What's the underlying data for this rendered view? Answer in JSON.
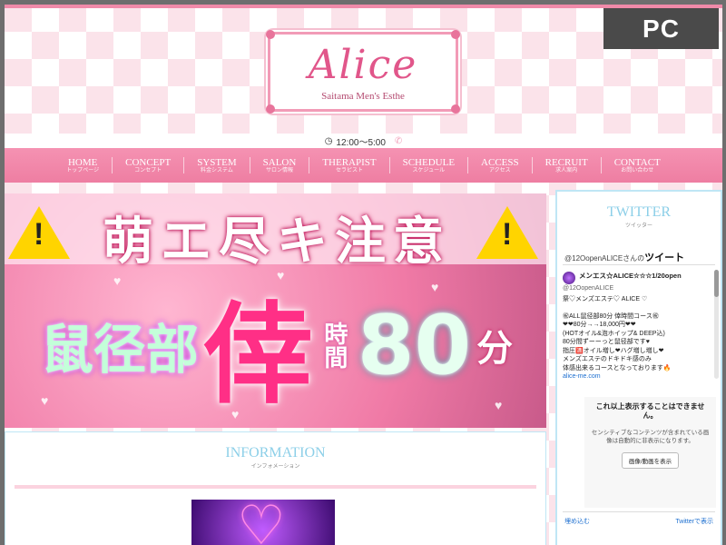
{
  "badge": "PC",
  "brand": {
    "logo": "Alice",
    "tagline": "Saitama Men's Esthe",
    "color": "#e1568a"
  },
  "hours": {
    "icon": "clock-icon",
    "text": "12:00～5:00",
    "phone_icon": "phone-icon"
  },
  "nav": [
    {
      "en": "HOME",
      "jp": "トップページ"
    },
    {
      "en": "CONCEPT",
      "jp": "コンセプト"
    },
    {
      "en": "SYSTEM",
      "jp": "料金システム"
    },
    {
      "en": "SALON",
      "jp": "サロン情報"
    },
    {
      "en": "THERAPIST",
      "jp": "セラピスト"
    },
    {
      "en": "SCHEDULE",
      "jp": "スケジュール"
    },
    {
      "en": "ACCESS",
      "jp": "アクセス"
    },
    {
      "en": "RECRUIT",
      "jp": "求人案内"
    },
    {
      "en": "CONTACT",
      "jp": "お問い合わせ"
    }
  ],
  "banner": {
    "title": "萌エ尽キ注意",
    "line_a": "鼠径部",
    "line_b": "倖",
    "line_c": "時間",
    "line_d": "80",
    "line_e": "分"
  },
  "info": {
    "title": "INFORMATION",
    "sub": "インフォメーション"
  },
  "twitter": {
    "title": "TWITTER",
    "sub": "ツイッター",
    "header_prefix": "@12OopenALICEさんの",
    "header_main": "ツイート",
    "tweet": {
      "name": "メンエス☆ALICE☆☆☆1/20open",
      "handle": "@12OopenALICE",
      "lines": [
        "祭♡メンズエステ♡ ALICE ♡",
        "",
        "㊗ALL鼠径部80分 倖時間コース㊗",
        "❤❤80分→→18,000円❤❤",
        "(HOTオイル&泡ホイップ& DEEP込)",
        "80分間ずーーっと鼠径部です♥",
        "指圧🈵オイル増し❤ハグ増し増し❤",
        "メンズエステのドキドキ感のみ",
        "体感出来るコースとなっております🔥"
      ],
      "link": "alice-me.com"
    },
    "sensitive": {
      "title": "これ以上表示することはできません。",
      "text": "センシティブなコンテンツが含まれている画像は自動的に非表示になります。",
      "button": "画像/動画を表示"
    },
    "embed": "埋め込む",
    "view": "Twitterで表示"
  }
}
